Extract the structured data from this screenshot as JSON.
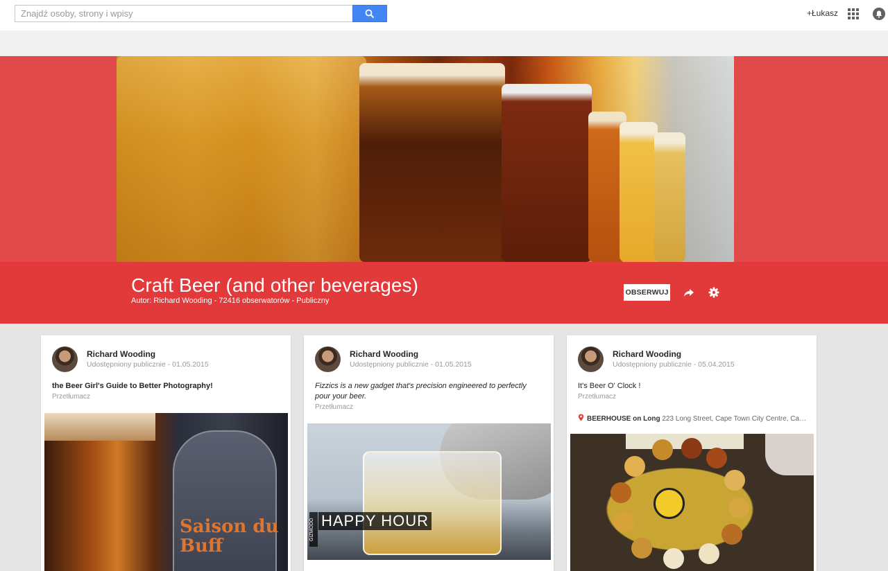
{
  "search": {
    "placeholder": "Znajdź osoby, strony i wpisy"
  },
  "header": {
    "user": "+Łukasz"
  },
  "community": {
    "title": "Craft Beer (and other beverages)",
    "meta": "Autor: Richard Wooding - 72416 obserwatorów - Publiczny",
    "follow_label": "OBSERWUJ"
  },
  "posts": [
    {
      "author": "Richard Wooding",
      "meta": "Udostępniony publicznie  -  01.05.2015",
      "text": "the Beer Girl's Guide to Better Photography!",
      "translate": "Przetłumacz",
      "image_text": "Saison du Buff"
    },
    {
      "author": "Richard Wooding",
      "meta": "Udostępniony publicznie  -  01.05.2015",
      "text": "Fizzics is a new gadget that's precision engineered to perfectly pour your beer.",
      "translate": "Przetłumacz",
      "image_text": "HAPPY HOUR",
      "image_side_text": "GIZMODO"
    },
    {
      "author": "Richard Wooding",
      "meta": "Udostępniony publicznie  -  05.04.2015",
      "text": "It's Beer O' Clock !",
      "translate": "Przetłumacz",
      "location_name": "BEERHOUSE on Long",
      "location_address": "223 Long Street, Cape Town City Centre, Cape ..."
    }
  ]
}
